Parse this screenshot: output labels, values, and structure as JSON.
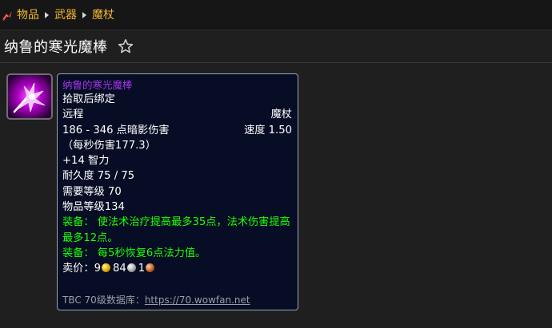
{
  "breadcrumb": {
    "logo_icon": "wowfan-logo-icon",
    "items": [
      {
        "label": "物品"
      },
      {
        "label": "武器"
      },
      {
        "label": "魔杖"
      }
    ]
  },
  "page": {
    "title": "纳鲁的寒光魔棒",
    "favorite_icon": "star-outline-icon"
  },
  "item": {
    "icon": "crystal-wand-icon",
    "name": "纳鲁的寒光魔棒",
    "quality_color": "#a335ee",
    "bind": "拾取后绑定",
    "slot": "远程",
    "type": "魔杖",
    "damage": "186 - 346 点暗影伤害",
    "speed": "速度 1.50",
    "dps": "（每秒伤害177.3）",
    "intellect": "+14 智力",
    "durability": "耐久度 75 / 75",
    "required_level": "需要等级 70",
    "item_level": "物品等级134",
    "equip_effects": [
      "装备： 使法术治疗提高最多35点，法术伤害提高最多12点。",
      "装备： 每5秒恢复6点法力值。"
    ],
    "sell_price": {
      "label": "卖价：",
      "gold": "9",
      "silver": "84",
      "copper": "1"
    },
    "footer": {
      "label": "TBC 70级数据库：",
      "link": "https://70.wowfan.net"
    }
  },
  "colors": {
    "breadcrumb": "#f2b632",
    "equip_green": "#1eff00",
    "tooltip_bg": "#070d24"
  }
}
